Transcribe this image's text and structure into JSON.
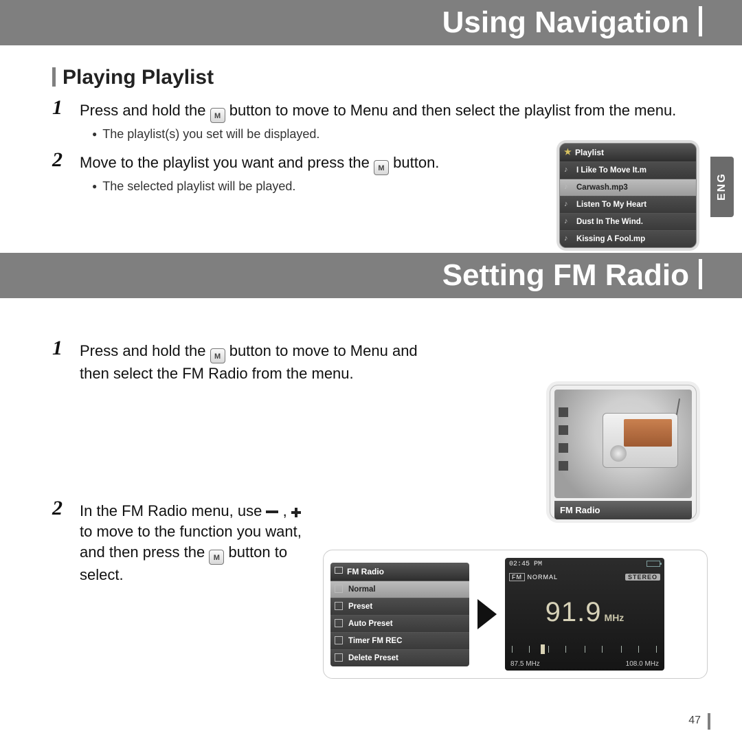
{
  "header1": "Using Navigation",
  "subhead1": "Playing Playlist",
  "s1_step1a": "Press and hold the ",
  "s1_step1b": " button to move to Menu and then select the playlist from the menu.",
  "s1_bullet1": "The playlist(s) you set will be displayed.",
  "s1_step2a": "Move to the playlist you want and press the ",
  "s1_step2b": " button.",
  "s1_bullet2": "The selected playlist will be played.",
  "lang_tab": "ENG",
  "playlist": {
    "title": "Playlist",
    "items": [
      "I Like To Move It.m",
      "Carwash.mp3",
      "Listen To My Heart",
      "Dust In The Wind.",
      "Kissing A Fool.mp"
    ]
  },
  "header2": "Setting FM Radio",
  "s2_step1a": "Press and hold the ",
  "s2_step1b": " button to move to Menu and then select the FM Radio from the menu.",
  "fm_caption": "FM Radio",
  "s2_step2a": "In the FM Radio menu, use ",
  "s2_step2b": " to move to the function you want, and then press the ",
  "s2_step2c": " button to select.",
  "fm_menu": {
    "title": "FM Radio",
    "items": [
      "Normal",
      "Preset",
      "Auto Preset",
      "Timer FM REC",
      "Delete Preset"
    ]
  },
  "tuner": {
    "time": "02:45 PM",
    "fm_label": "FM",
    "mode": "NORMAL",
    "stereo": "STEREO",
    "freq": "91.9",
    "unit": "MHz",
    "low": "87.5 MHz",
    "high": "108.0 MHz"
  },
  "page_num": "47",
  "m_label": "M"
}
